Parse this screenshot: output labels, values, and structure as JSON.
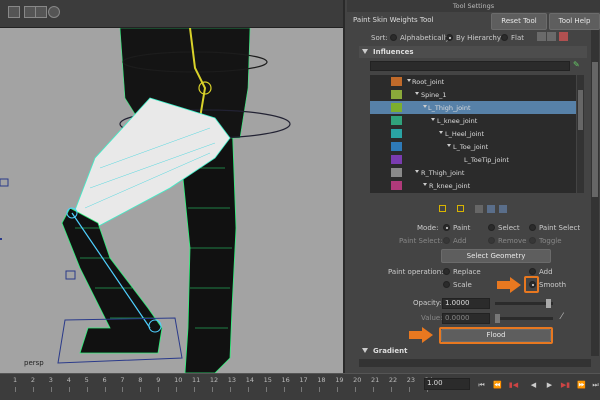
{
  "window": {
    "title": "Tool Settings"
  },
  "tool": {
    "name": "Paint Skin Weights Tool",
    "reset_label": "Reset Tool",
    "help_label": "Tool Help"
  },
  "sort": {
    "label": "Sort:",
    "options": [
      "Alphabetically",
      "By Hierarchy",
      "Flat"
    ],
    "selected": "By Hierarchy"
  },
  "influences": {
    "header": "Influences",
    "search_value": "",
    "joints": [
      {
        "name": "Root_joint",
        "color": "#c06a2a",
        "selected": false
      },
      {
        "name": "Spine_1",
        "color": "#8aa93a",
        "selected": false
      },
      {
        "name": "L_Thigh_joint",
        "color": "#7cae2e",
        "selected": true
      },
      {
        "name": "L_knee_joint",
        "color": "#30a27c",
        "selected": false
      },
      {
        "name": "L_Heel_joint",
        "color": "#2aa4a4",
        "selected": false
      },
      {
        "name": "L_Toe_joint",
        "color": "#2e7ab8",
        "selected": false
      },
      {
        "name": "L_ToeTip_joint",
        "color": "#7a3cb0",
        "selected": false
      },
      {
        "name": "R_Thigh_joint",
        "color": "#8a8a8a",
        "selected": false
      },
      {
        "name": "R_knee_joint",
        "color": "#b03a7a",
        "selected": false
      }
    ]
  },
  "mode": {
    "label": "Mode:",
    "options": [
      "Paint",
      "Select",
      "Paint Select"
    ],
    "selected": "Paint"
  },
  "paint_select": {
    "label": "Paint Select:",
    "options": [
      "Add",
      "Remove",
      "Toggle"
    ]
  },
  "select_geometry_label": "Select Geometry",
  "paint_operation": {
    "label": "Paint operation:",
    "options": [
      "Replace",
      "Add",
      "Scale",
      "Smooth"
    ],
    "selected": "Smooth"
  },
  "opacity": {
    "label": "Opacity:",
    "value": "1.0000",
    "level": 0.97
  },
  "value": {
    "label": "Value:",
    "value": "0.0000",
    "level": 0.0
  },
  "flood_label": "Flood",
  "gradient_header": "Gradient",
  "viewport": {
    "camera_label": "persp"
  },
  "timeline": {
    "ticks": [
      "1",
      "2",
      "3",
      "4",
      "5",
      "6",
      "7",
      "8",
      "9",
      "10",
      "11",
      "12",
      "13",
      "14",
      "15",
      "16",
      "17",
      "18",
      "19",
      "20",
      "21",
      "22",
      "23",
      "24"
    ],
    "current_frame": "1.00"
  },
  "colors": {
    "highlight": "#e87820",
    "selection": "#5781a8",
    "panel_bg": "#444444"
  }
}
